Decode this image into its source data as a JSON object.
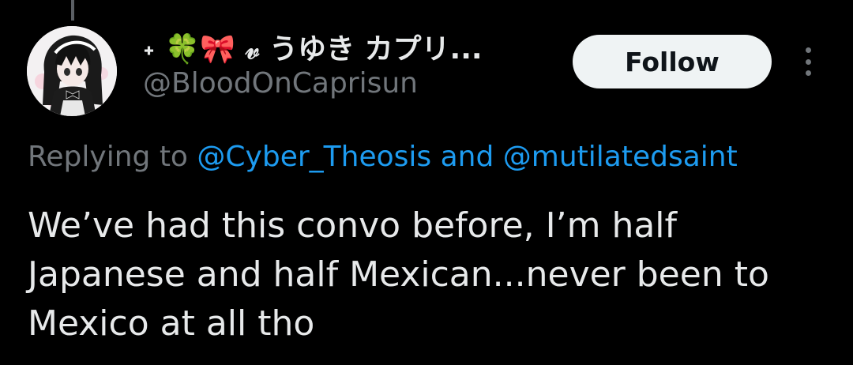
{
  "tweet": {
    "author": {
      "display_name": "˖ 🍀🎀 𝓋 うゆき カプリ...",
      "handle": "@BloodOnCaprisun",
      "avatar_icon": "anime-girl-avatar"
    },
    "follow_label": "Follow",
    "more_icon": "more-options-icon",
    "replying_to": {
      "prefix": "Replying to ",
      "first_mention": "@Cyber_Theosis",
      "conjunction": " and ",
      "second_mention": "@mutilatedsaint"
    },
    "text": "We’ve had this convo before, I’m half Japanese and half Mexican...never been to Mexico at all tho"
  },
  "colors": {
    "background": "#000000",
    "primary_text": "#e7e9ea",
    "secondary_text": "#71767b",
    "link": "#1d9bf0",
    "follow_bg": "#eff3f4",
    "follow_text": "#0f1419"
  }
}
